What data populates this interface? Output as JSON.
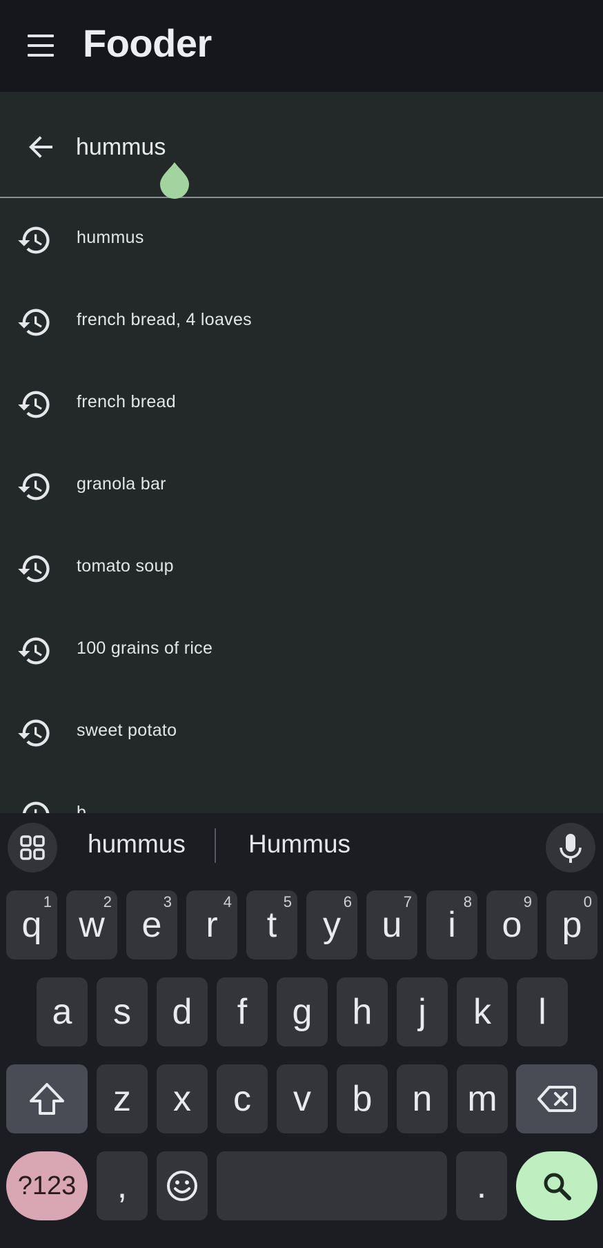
{
  "app": {
    "title": "Fooder",
    "menu_icon": "hamburger-menu-icon"
  },
  "search": {
    "value": "hummus",
    "back_icon": "arrow-back-icon",
    "handle_color": "#a3d4a0"
  },
  "history": {
    "icon": "history-icon",
    "items": [
      {
        "label": "hummus"
      },
      {
        "label": "french bread, 4 loaves"
      },
      {
        "label": "french bread"
      },
      {
        "label": "granola bar"
      },
      {
        "label": "tomato soup"
      },
      {
        "label": "100 grains of rice"
      },
      {
        "label": "sweet potato"
      },
      {
        "label": "b"
      }
    ]
  },
  "keyboard": {
    "suggestions": [
      "hummus",
      "Hummus"
    ],
    "row1": [
      {
        "key": "q",
        "hint": "1"
      },
      {
        "key": "w",
        "hint": "2"
      },
      {
        "key": "e",
        "hint": "3"
      },
      {
        "key": "r",
        "hint": "4"
      },
      {
        "key": "t",
        "hint": "5"
      },
      {
        "key": "y",
        "hint": "6"
      },
      {
        "key": "u",
        "hint": "7"
      },
      {
        "key": "i",
        "hint": "8"
      },
      {
        "key": "o",
        "hint": "9"
      },
      {
        "key": "p",
        "hint": "0"
      }
    ],
    "row2": [
      "a",
      "s",
      "d",
      "f",
      "g",
      "h",
      "j",
      "k",
      "l"
    ],
    "row3": [
      "z",
      "x",
      "c",
      "v",
      "b",
      "n",
      "m"
    ],
    "symbols_label": "?123",
    "comma_label": ",",
    "period_label": ".",
    "colors": {
      "symbols_key": "#d9a7b3",
      "enter_key": "#bfefc0"
    }
  }
}
